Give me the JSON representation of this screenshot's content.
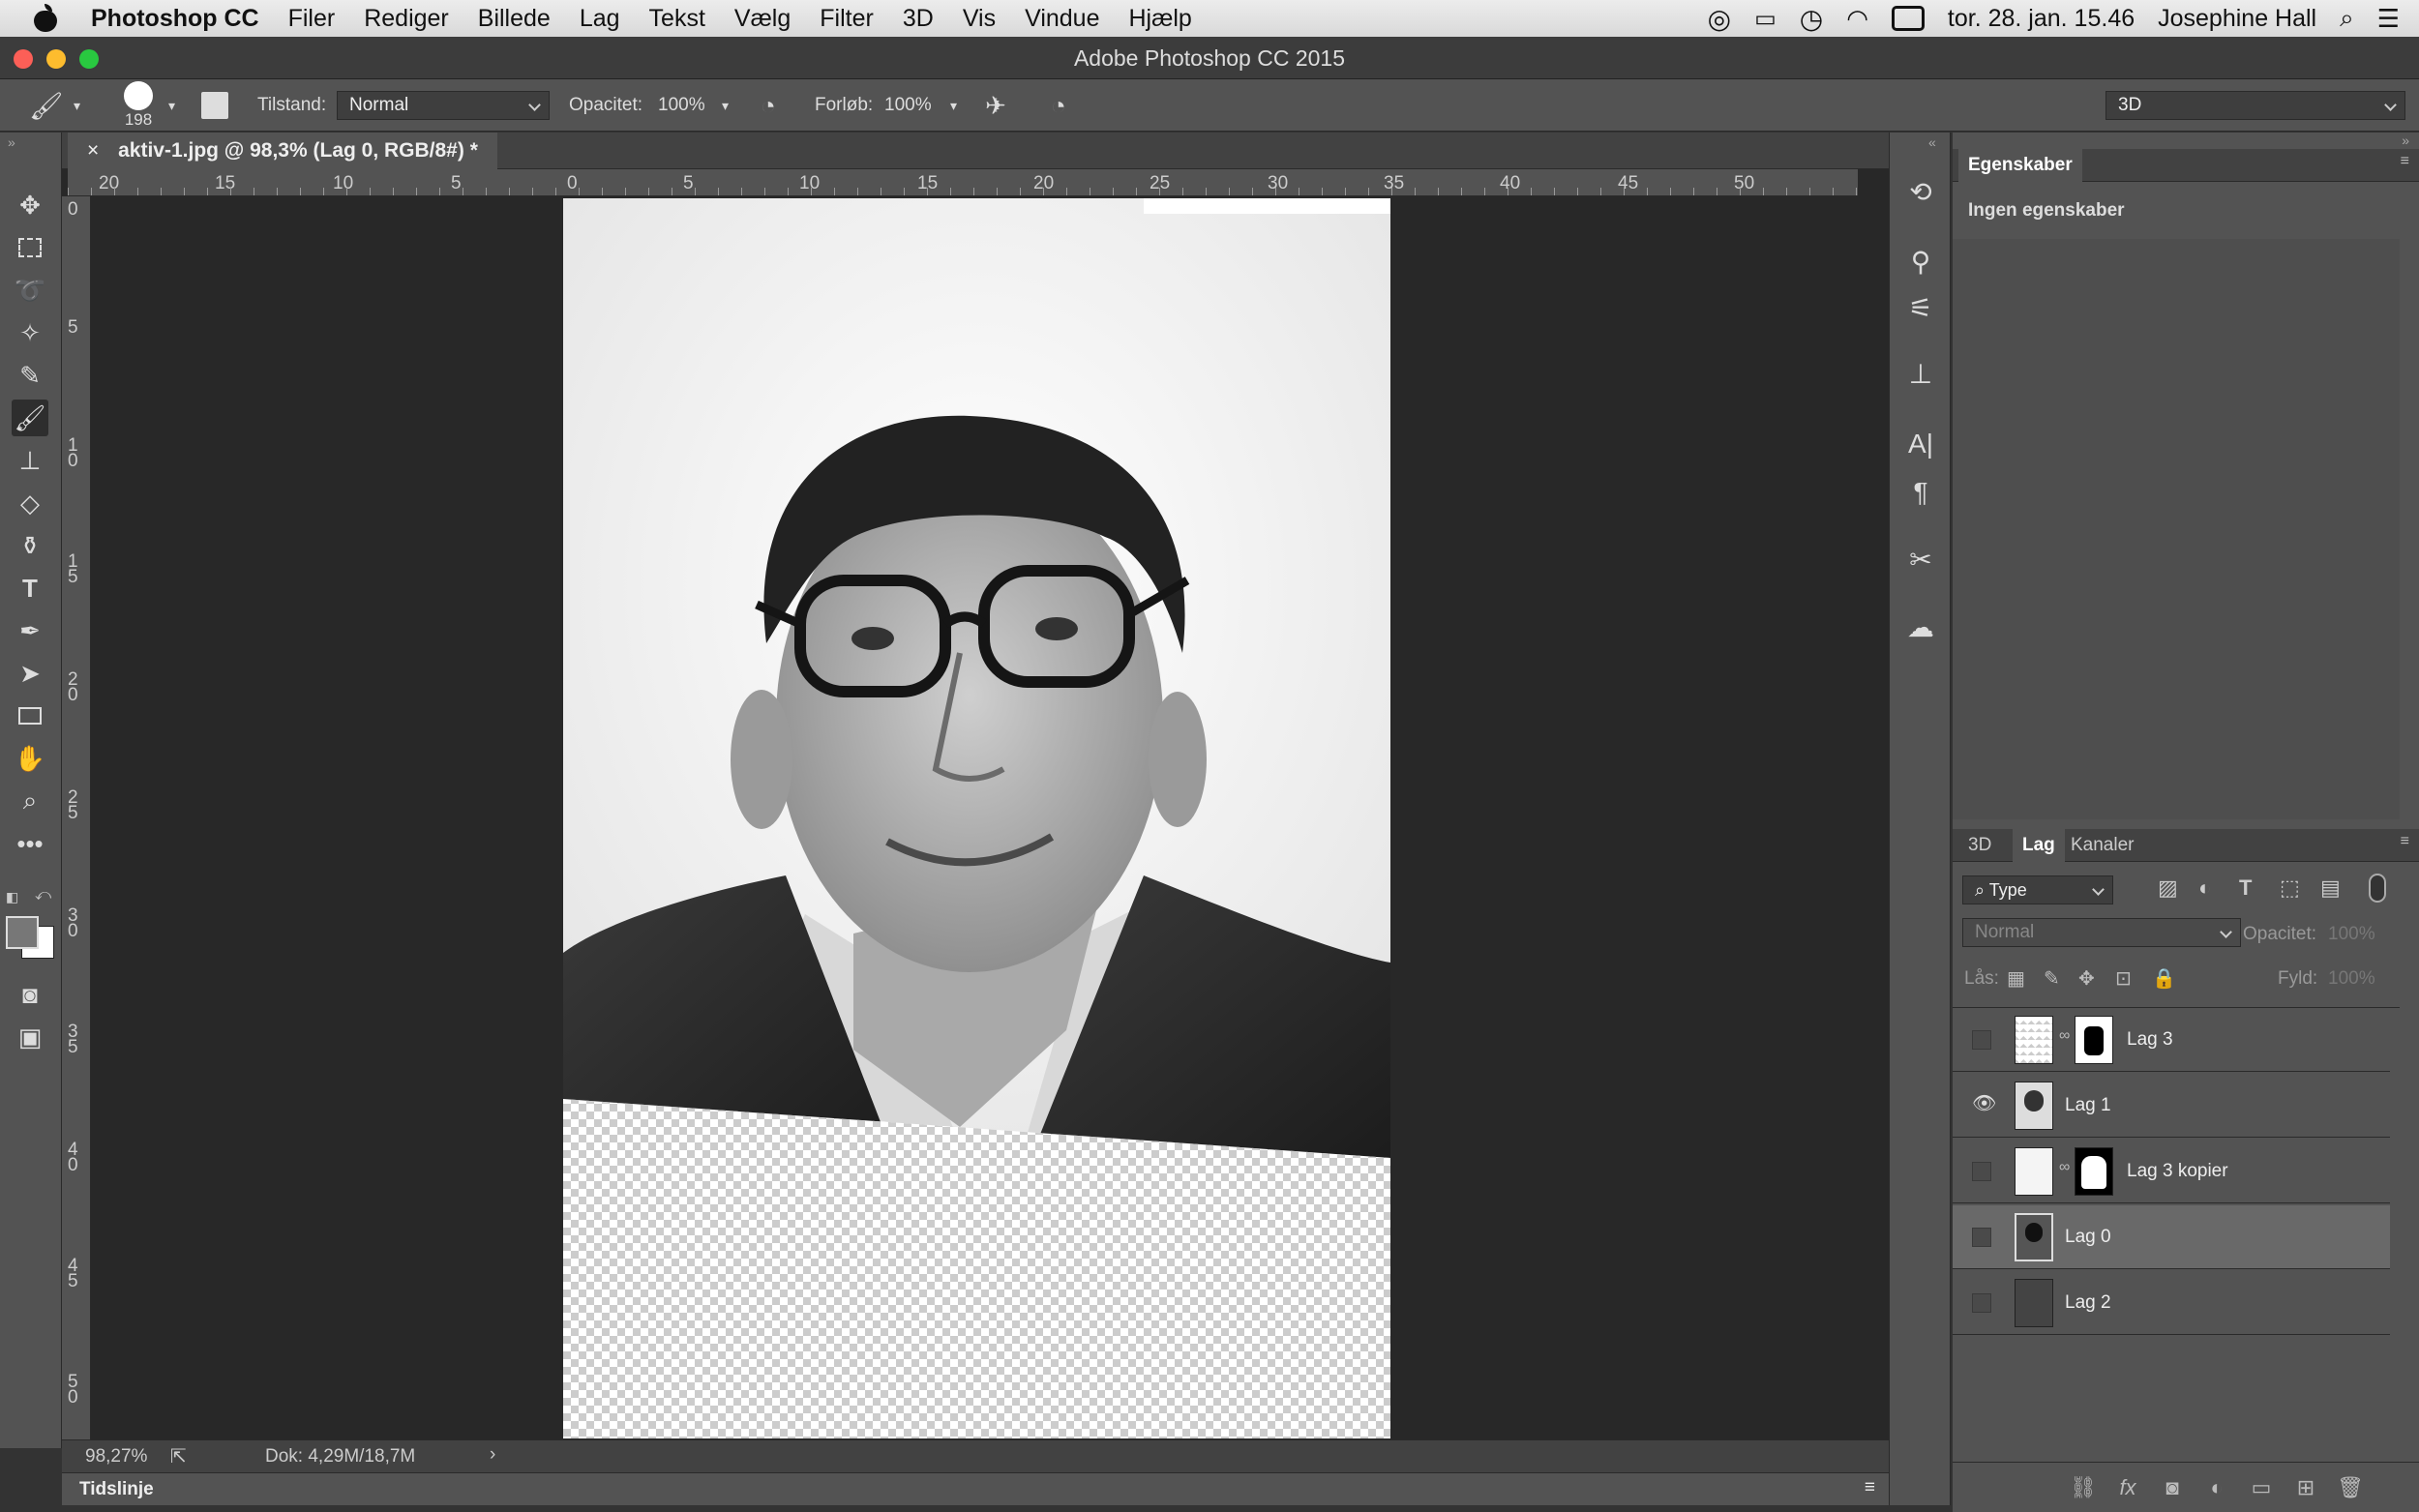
{
  "menubar": {
    "app_name": "Photoshop CC",
    "items": [
      "Filer",
      "Rediger",
      "Billede",
      "Lag",
      "Tekst",
      "Vælg",
      "Filter",
      "3D",
      "Vis",
      "Vindue",
      "Hjælp"
    ],
    "clock": "tor. 28. jan. 15.46",
    "user": "Josephine Hall"
  },
  "window": {
    "title": "Adobe Photoshop CC 2015"
  },
  "options": {
    "brush_size": "198",
    "mode_label": "Tilstand:",
    "mode_value": "Normal",
    "opacity_label": "Opacitet:",
    "opacity_value": "100%",
    "flow_label": "Forløb:",
    "flow_value": "100%",
    "workspace": "3D"
  },
  "document": {
    "tab_title": "aktiv-1.jpg @ 98,3% (Lag 0, RGB/8#) *",
    "ruler_top": [
      "20",
      "15",
      "10",
      "5",
      "0",
      "5",
      "10",
      "15",
      "20",
      "25",
      "30",
      "35",
      "40",
      "45",
      "50"
    ],
    "ruler_left": [
      "0",
      "5",
      "1\n0",
      "1\n5",
      "2\n0",
      "2\n5",
      "3\n0",
      "3\n5",
      "4\n0",
      "4\n5",
      "5\n0"
    ]
  },
  "status": {
    "zoom": "98,27%",
    "doc_size": "Dok: 4,29M/18,7M"
  },
  "timeline": {
    "label": "Tidslinje"
  },
  "properties": {
    "tab": "Egenskaber",
    "empty_text": "Ingen egenskaber"
  },
  "layers_panel": {
    "tabs": [
      "3D",
      "Lag",
      "Kanaler"
    ],
    "filter_type": "Type",
    "blend_mode": "Normal",
    "opacity_label": "Opacitet:",
    "opacity_value": "100%",
    "lock_label": "Lås:",
    "fill_label": "Fyld:",
    "fill_value": "100%",
    "layers": [
      {
        "name": "Lag 3",
        "visible": false,
        "mask": true,
        "selected": false
      },
      {
        "name": "Lag 1",
        "visible": true,
        "mask": false,
        "selected": false
      },
      {
        "name": "Lag 3 kopier",
        "visible": false,
        "mask": true,
        "selected": false
      },
      {
        "name": "Lag 0",
        "visible": false,
        "mask": false,
        "selected": true
      },
      {
        "name": "Lag 2",
        "visible": false,
        "mask": false,
        "selected": false
      }
    ]
  },
  "colors": {
    "foreground": "#777777",
    "background": "#ffffff"
  }
}
